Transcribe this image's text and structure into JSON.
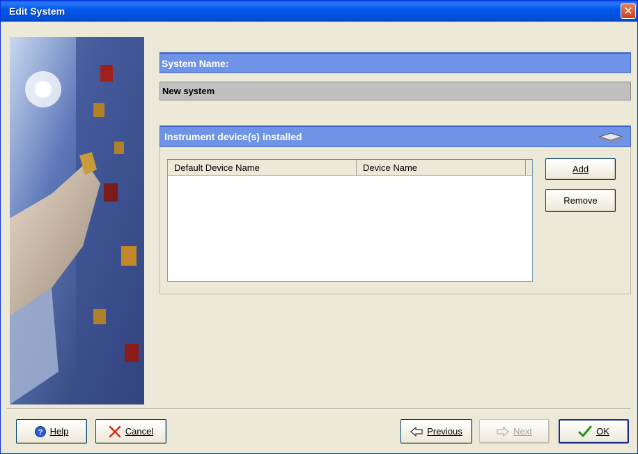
{
  "window": {
    "title": "Edit System"
  },
  "system_name": {
    "header": "System Name:",
    "value": "New system"
  },
  "instruments": {
    "header": "Instrument device(s) installed",
    "columns": [
      "Default Device Name",
      "Device Name"
    ],
    "rows": [],
    "add_label": "Add",
    "remove_label": "Remove"
  },
  "footer": {
    "help_label": "Help",
    "cancel_label": "Cancel",
    "previous_label": "Previous",
    "next_label": "Next",
    "ok_label": "OK"
  },
  "icons": {
    "close": "close-icon",
    "device": "instrument-device-icon",
    "help": "help-question-icon",
    "cancel": "cancel-x-icon",
    "previous": "arrow-left-icon",
    "next": "arrow-right-icon",
    "ok": "checkmark-icon"
  },
  "colors": {
    "titlebar": "#0058e8",
    "section_header": "#6f93e6",
    "dialog_bg": "#ece9d8",
    "cancel_red": "#d42a12",
    "ok_green": "#2e8b1e"
  }
}
